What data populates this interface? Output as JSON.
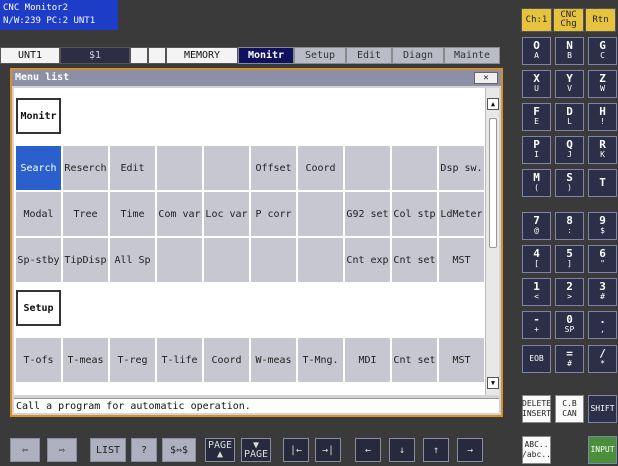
{
  "system_status": {
    "line1": "CNC Monitor2",
    "line2": "N/W:239 PC:2 UNT1"
  },
  "mode_bar": {
    "unit": "UNT1",
    "system": "$1",
    "mode": "MEMORY"
  },
  "main_tabs": [
    {
      "label": "Monitr",
      "active": true
    },
    {
      "label": "Setup",
      "active": false
    },
    {
      "label": "Edit",
      "active": false
    },
    {
      "label": "Diagn",
      "active": false
    },
    {
      "label": "Mainte",
      "active": false
    }
  ],
  "top_buttons": {
    "channel": "Ch:1",
    "change_line1": "CNC",
    "change_line2": "Chg",
    "return": "Rtn"
  },
  "dialog": {
    "title": "Menu list",
    "close_icon": "close-icon",
    "groups": [
      {
        "label": "Monitr",
        "rows": [
          [
            "Search",
            "Reserch",
            "Edit",
            "",
            "",
            "Offset",
            "Coord",
            "",
            "",
            "Dsp sw."
          ],
          [
            "Modal",
            "Tree",
            "Time",
            "Com var",
            "Loc var",
            "P corr",
            "",
            "G92 set",
            "Col stp",
            "LdMeter"
          ],
          [
            "Sp-stby",
            "TipDisp",
            "All Sp",
            "",
            "",
            "",
            "",
            "Cnt exp",
            "Cnt set",
            "MST"
          ]
        ]
      },
      {
        "label": "Setup",
        "rows": [
          [
            "T-ofs",
            "T-meas",
            "T-reg",
            "T-life",
            "Coord",
            "W-meas",
            "T-Mng.",
            "MDI",
            "Cnt set",
            "MST"
          ]
        ]
      }
    ],
    "selected_item": "Search",
    "message": "Call a program for automatic operation."
  },
  "keypad": {
    "rows": [
      [
        [
          "O",
          "A"
        ],
        [
          "N",
          "B"
        ],
        [
          "G",
          "C"
        ]
      ],
      [
        [
          "X",
          "U"
        ],
        [
          "Y",
          "V"
        ],
        [
          "Z",
          "W"
        ]
      ],
      [
        [
          "F",
          "E"
        ],
        [
          "D",
          "L"
        ],
        [
          "H",
          "!"
        ]
      ],
      [
        [
          "P",
          "I"
        ],
        [
          "Q",
          "J"
        ],
        [
          "R",
          "K"
        ]
      ],
      [
        [
          "M",
          "("
        ],
        [
          "S",
          ")"
        ],
        [
          "T",
          ""
        ]
      ],
      [
        [
          "7",
          "@"
        ],
        [
          "8",
          ":"
        ],
        [
          "9",
          "$"
        ]
      ],
      [
        [
          "4",
          "["
        ],
        [
          "5",
          "]"
        ],
        [
          "6",
          "\""
        ]
      ],
      [
        [
          "1",
          "<"
        ],
        [
          "2",
          ">"
        ],
        [
          "3",
          "#"
        ]
      ],
      [
        [
          "-",
          "+"
        ],
        [
          "0",
          "SP"
        ],
        [
          ".",
          ","
        ]
      ],
      [
        [
          "EOB",
          ""
        ],
        [
          "=",
          "#"
        ],
        [
          "/",
          "*"
        ]
      ]
    ],
    "delete_line1": "DELETE",
    "delete_line2": "INSERT",
    "cb_line1": "C.B",
    "cb_line2": "CAN",
    "shift": "SHIFT",
    "abc_line1": "ABC..",
    "abc_line2": "/abc..",
    "input": "INPUT"
  },
  "toolbar": {
    "list": "LIST",
    "help": "?",
    "swap": "$⇔$",
    "page_up_line1": "PAGE",
    "page_up_line2": "▲",
    "page_down_line1": "▼",
    "page_down_line2": "PAGE",
    "home": "|←",
    "end": "→|",
    "left": "←",
    "down": "↓",
    "up": "↑",
    "right": "→"
  },
  "colors": {
    "accent_selected": "#2b5fcc",
    "dialog_border": "#d6902a",
    "active_tab": "#101060",
    "sys_status": "#1d3cc7",
    "input_key": "#4a8f3a"
  }
}
